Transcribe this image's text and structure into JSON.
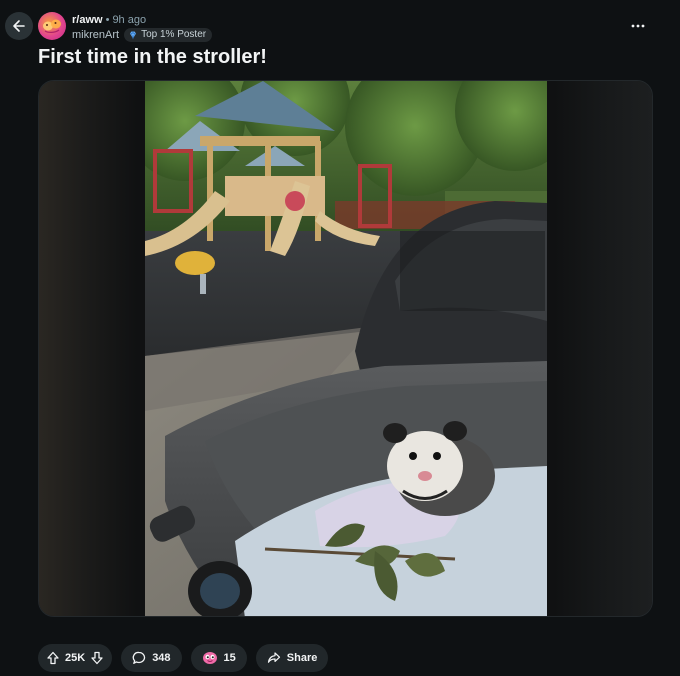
{
  "post": {
    "subreddit": "r/aww",
    "separator": "•",
    "time_ago": "9h ago",
    "author": "mikrenArt",
    "author_badge": "Top 1% Poster",
    "title": "First time in the stroller!"
  },
  "actions": {
    "upvotes": "25K",
    "comments": "348",
    "awards": "15",
    "share_label": "Share"
  },
  "icons": {
    "back": "arrow-left-icon",
    "more": "more-horizontal-icon",
    "upvote": "arrow-up-icon",
    "downvote": "arrow-down-icon",
    "comment": "speech-bubble-icon",
    "award": "award-icon",
    "share": "share-icon"
  },
  "colors": {
    "background": "#0e1113",
    "pill": "#21272a",
    "text": "#f2f4f5",
    "muted": "#8ba2ad"
  }
}
